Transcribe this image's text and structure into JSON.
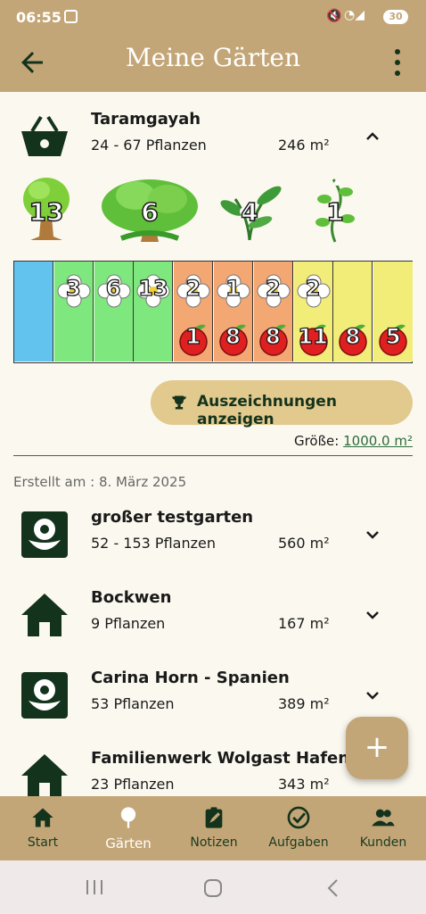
{
  "status_bar": {
    "time": "06:55",
    "battery": "30"
  },
  "app_bar": {
    "title": "Meine Gärten"
  },
  "expanded_garden": {
    "name": "Taramgayah",
    "plants": "24 - 67 Pflanzen",
    "area": "246 m²",
    "plant_types": [
      {
        "icon": "tree-icon",
        "count": "13"
      },
      {
        "icon": "bush-icon",
        "count": "6"
      },
      {
        "icon": "herb-icon",
        "count": "4"
      },
      {
        "icon": "vine-icon",
        "count": "1"
      }
    ],
    "beds": [
      {
        "color": "#63c3ef",
        "flower": "",
        "fruit": ""
      },
      {
        "color": "#7ee87e",
        "flower": "3",
        "fruit": ""
      },
      {
        "color": "#7ee87e",
        "flower": "6",
        "fruit": ""
      },
      {
        "color": "#7ee87e",
        "flower": "13",
        "fruit": ""
      },
      {
        "color": "#f3a772",
        "flower": "2",
        "fruit": "1"
      },
      {
        "color": "#f3a772",
        "flower": "1",
        "fruit": "8"
      },
      {
        "color": "#f3a772",
        "flower": "2",
        "fruit": "8"
      },
      {
        "color": "#f2ec78",
        "flower": "2",
        "fruit": "11"
      },
      {
        "color": "#f2ec78",
        "flower": "",
        "fruit": "8"
      },
      {
        "color": "#f2ec78",
        "flower": "",
        "fruit": "5"
      }
    ],
    "awards_button": "Auszeichnungen anzeigen",
    "size_label": "Größe:",
    "size_value": "1000.0 m²",
    "created": "Erstellt am : 8. März 2025"
  },
  "gardens": [
    {
      "icon": "flower-icon",
      "name": "großer testgarten",
      "plants": "52 - 153 Pflanzen",
      "area": "560 m²"
    },
    {
      "icon": "house-icon",
      "name": "Bockwen",
      "plants": "9 Pflanzen",
      "area": "167 m²"
    },
    {
      "icon": "flower-icon",
      "name": "Carina Horn - Spanien",
      "plants": "53 Pflanzen",
      "area": "389 m²"
    },
    {
      "icon": "house-icon",
      "name": "Familienwerk Wolgast Hafen",
      "plants": "23 Pflanzen",
      "area": "343 m²"
    }
  ],
  "fab": "+",
  "bottom_nav": [
    {
      "icon": "home-icon",
      "label": "Start"
    },
    {
      "icon": "tree-icon",
      "label": "Gärten"
    },
    {
      "icon": "note-icon",
      "label": "Notizen"
    },
    {
      "icon": "check-icon",
      "label": "Aufgaben"
    },
    {
      "icon": "people-icon",
      "label": "Kunden"
    }
  ],
  "colors": {
    "brand": "#c3a677",
    "dark_green": "#14331c",
    "button": "#e2c98e"
  }
}
